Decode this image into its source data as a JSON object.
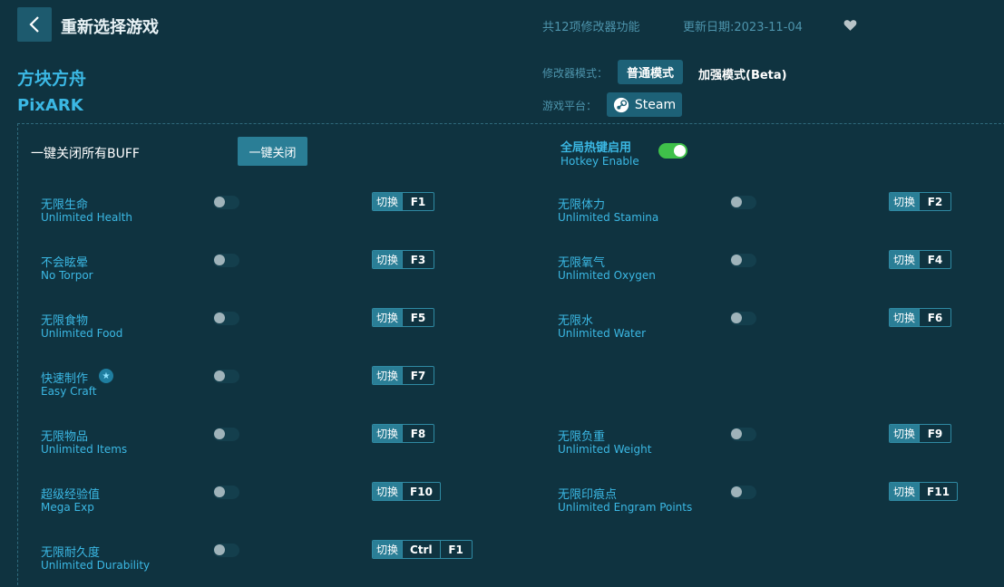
{
  "header": {
    "back_icon": "chevron-left-icon",
    "title": "重新选择游戏",
    "feature_count": "共12项修改器功能",
    "update_date": "更新日期:2023-11-04",
    "favorite_icon": "heart-icon"
  },
  "game": {
    "name_cn": "方块方舟",
    "name_en": "PixARK"
  },
  "mode": {
    "label": "修改器模式：",
    "normal": "普通模式",
    "enhanced": "加强模式(Beta)"
  },
  "platform": {
    "label": "游戏平台：",
    "steam": "Steam",
    "steam_icon": "steam-icon"
  },
  "panel": {
    "close_all_label": "一键关闭所有BUFF",
    "close_all_button": "一键关闭",
    "hotkey_cn": "全局热键启用",
    "hotkey_en": "Hotkey Enable",
    "hotkey_enabled": true
  },
  "switch_label": "切换",
  "colors": {
    "background": "#0f3340",
    "accent": "#3bb8e4",
    "button": "#1d6177",
    "toggle_on": "#3fc14a"
  },
  "cheats": [
    {
      "cn": "无限生命",
      "en": "Unlimited Health",
      "keys": [
        "F1"
      ],
      "on": false
    },
    {
      "cn": "无限体力",
      "en": "Unlimited Stamina",
      "keys": [
        "F2"
      ],
      "on": false
    },
    {
      "cn": "不会眩晕",
      "en": "No Torpor",
      "keys": [
        "F3"
      ],
      "on": false
    },
    {
      "cn": "无限氧气",
      "en": "Unlimited Oxygen",
      "keys": [
        "F4"
      ],
      "on": false
    },
    {
      "cn": "无限食物",
      "en": "Unlimited Food",
      "keys": [
        "F5"
      ],
      "on": false
    },
    {
      "cn": "无限水",
      "en": "Unlimited Water",
      "keys": [
        "F6"
      ],
      "on": false
    },
    {
      "cn": "快速制作",
      "en": "Easy Craft",
      "keys": [
        "F7"
      ],
      "on": false,
      "starred": true
    },
    {
      "cn": "无限物品",
      "en": "Unlimited Items",
      "keys": [
        "F8"
      ],
      "on": false
    },
    {
      "cn": "无限负重",
      "en": "Unlimited Weight",
      "keys": [
        "F9"
      ],
      "on": false
    },
    {
      "cn": "超级经验值",
      "en": "Mega Exp",
      "keys": [
        "F10"
      ],
      "on": false
    },
    {
      "cn": "无限印痕点",
      "en": "Unlimited Engram Points",
      "keys": [
        "F11"
      ],
      "on": false
    },
    {
      "cn": "无限耐久度",
      "en": "Unlimited Durability",
      "keys": [
        "Ctrl",
        "F1"
      ],
      "on": false
    }
  ]
}
